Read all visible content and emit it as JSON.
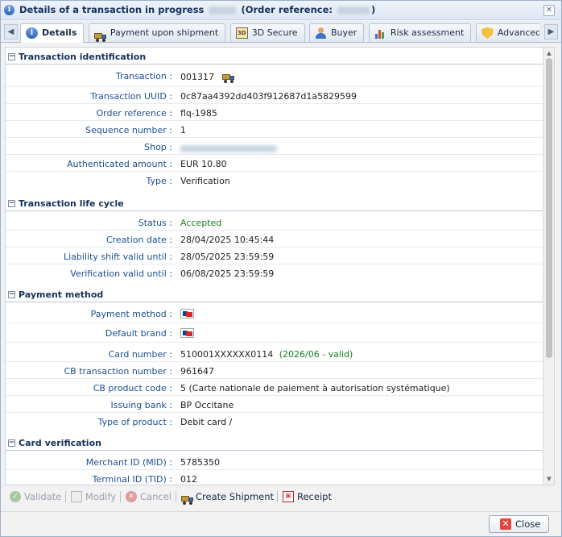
{
  "window": {
    "title_prefix": "Details of a transaction in progress",
    "title_mid": "(Order reference:",
    "title_suffix": ")"
  },
  "tabs": [
    {
      "label": "Details",
      "icon": "info-icon",
      "active": true
    },
    {
      "label": "Payment upon shipment",
      "icon": "truck-icon"
    },
    {
      "label": "3D Secure",
      "icon": "3d-secure-icon"
    },
    {
      "label": "Buyer",
      "icon": "buyer-icon"
    },
    {
      "label": "Risk assessment",
      "icon": "chart-icon"
    },
    {
      "label": "Advanced risk assessment",
      "icon": "shield-icon"
    }
  ],
  "sections": {
    "identification": {
      "title": "Transaction identification",
      "rows": {
        "transaction": {
          "label": "Transaction :",
          "value": "001317"
        },
        "uuid": {
          "label": "Transaction UUID :",
          "value": "0c87aa4392dd403f912687d1a5829599"
        },
        "order_ref": {
          "label": "Order reference :",
          "value": "flq-1985"
        },
        "sequence": {
          "label": "Sequence number :",
          "value": "1"
        },
        "shop": {
          "label": "Shop :",
          "value": ""
        },
        "amount": {
          "label": "Authenticated amount :",
          "value": "EUR 10.80"
        },
        "type": {
          "label": "Type :",
          "value": "Verification"
        }
      }
    },
    "lifecycle": {
      "title": "Transaction life cycle",
      "rows": {
        "status": {
          "label": "Status :",
          "value": "Accepted"
        },
        "creation": {
          "label": "Creation date :",
          "value": "28/04/2025 10:45:44"
        },
        "liability": {
          "label": "Liability shift valid until :",
          "value": "28/05/2025 23:59:59"
        },
        "verification": {
          "label": "Verification valid until :",
          "value": "06/08/2025 23:59:59"
        }
      }
    },
    "payment": {
      "title": "Payment method",
      "rows": {
        "method": {
          "label": "Payment method :"
        },
        "brand": {
          "label": "Default brand :"
        },
        "card": {
          "label": "Card number :",
          "value": "510001XXXXXX0114",
          "validity": "(2026/06 - valid)"
        },
        "cb_tx": {
          "label": "CB transaction number :",
          "value": "961647"
        },
        "cb_product": {
          "label": "CB product code :",
          "value": "5 (Carte nationale de paiement à autorisation systématique)"
        },
        "bank": {
          "label": "Issuing bank :",
          "value": "BP Occitane"
        },
        "product_type": {
          "label": "Type of product :",
          "value": "Debit card /"
        }
      }
    },
    "card_verification": {
      "title": "Card verification",
      "rows": {
        "mid": {
          "label": "Merchant ID (MID) :",
          "value": "5785350"
        },
        "tid": {
          "label": "Terminal ID (TID) :",
          "value": "012"
        }
      }
    }
  },
  "toolbar": {
    "validate": "Validate",
    "modify": "Modify",
    "cancel": "Cancel",
    "create_shipment": "Create Shipment",
    "receipt": "Receipt"
  },
  "close_label": "Close",
  "colors": {
    "accent": "#1c4f93",
    "success": "#16801d",
    "header": "#15325c"
  }
}
